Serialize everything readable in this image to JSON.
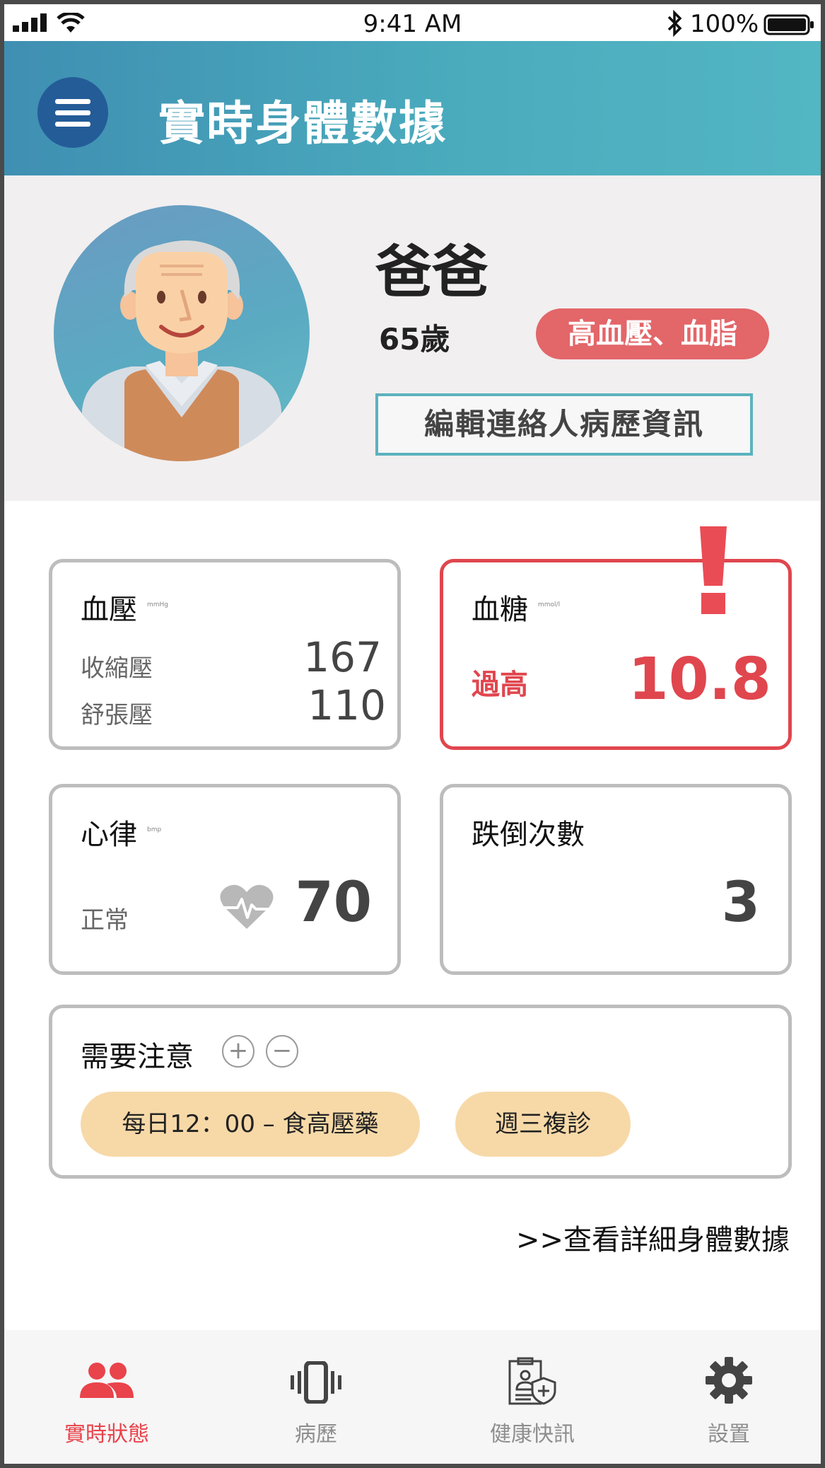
{
  "status_bar": {
    "time": "9:41 AM",
    "battery": "100%"
  },
  "header": {
    "title": "實時身體數據"
  },
  "profile": {
    "name": "爸爸",
    "age": "65歲",
    "condition": "高血壓、血脂",
    "edit_button": "編輯連絡人病歷資訊"
  },
  "blood_pressure": {
    "title": "血壓",
    "unit": "mmHg",
    "systolic_label": "收縮壓",
    "systolic_value": "167",
    "diastolic_label": "舒張壓",
    "diastolic_value": "110"
  },
  "blood_sugar": {
    "title": "血糖",
    "unit": "mmol/l",
    "status": "過高",
    "value": "10.8"
  },
  "heart_rate": {
    "title": "心律",
    "unit": "bmp",
    "status": "正常",
    "value": "70"
  },
  "falls": {
    "title": "跌倒次數",
    "value": "3"
  },
  "attention": {
    "title": "需要注意",
    "add_symbol": "+",
    "remove_symbol": "−",
    "items": [
      "每日12：00 – 食高壓藥",
      "週三複診"
    ]
  },
  "detail_link": ">>查看詳細身體數據",
  "bottom_nav": [
    {
      "label": "實時狀態",
      "icon": "people-icon",
      "active": true
    },
    {
      "label": "病歷",
      "icon": "vibrate-phone-icon",
      "active": false
    },
    {
      "label": "健康快訊",
      "icon": "medical-report-icon",
      "active": false
    },
    {
      "label": "設置",
      "icon": "gear-icon",
      "active": false
    }
  ],
  "colors": {
    "header_start": "#3f8fb2",
    "header_end": "#53b6c3",
    "alert_red": "#e0464e",
    "tag_red": "#e36669",
    "pill_peach": "#f7d9a8",
    "menu_blue": "#245c98"
  }
}
